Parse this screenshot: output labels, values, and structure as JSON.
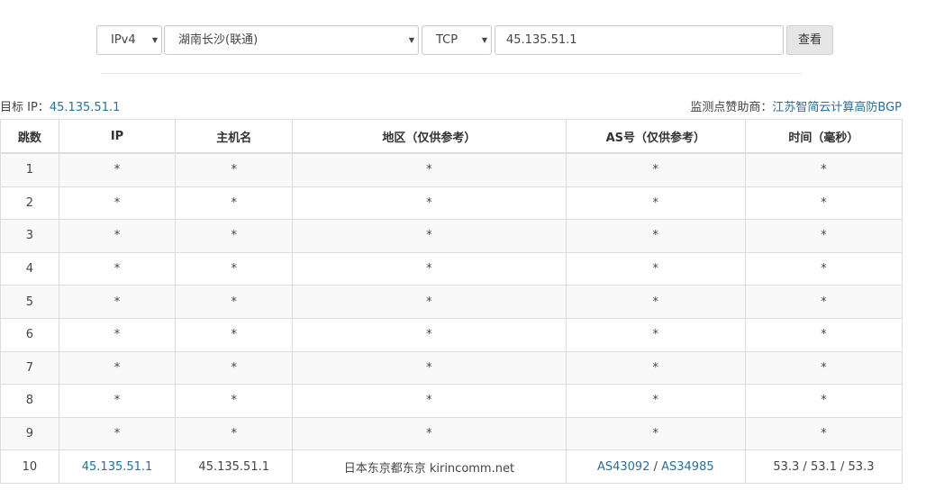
{
  "toolbar": {
    "ip_version": "IPv4",
    "node": "湖南长沙(联通)",
    "protocol": "TCP",
    "target_value": "45.135.51.1",
    "submit_label": "查看"
  },
  "info": {
    "target_label": "目标 IP：",
    "target_ip": "45.135.51.1",
    "sponsor_label": "监测点赞助商：",
    "sponsor_name": "江苏智简云计算高防BGP"
  },
  "table": {
    "headers": [
      "跳数",
      "IP",
      "主机名",
      "地区（仅供参考）",
      "AS号（仅供参考）",
      "时间（毫秒）"
    ],
    "rows": [
      {
        "hop": "1",
        "ip": "*",
        "host": "*",
        "location": "*",
        "as": "*",
        "time": "*"
      },
      {
        "hop": "2",
        "ip": "*",
        "host": "*",
        "location": "*",
        "as": "*",
        "time": "*"
      },
      {
        "hop": "3",
        "ip": "*",
        "host": "*",
        "location": "*",
        "as": "*",
        "time": "*"
      },
      {
        "hop": "4",
        "ip": "*",
        "host": "*",
        "location": "*",
        "as": "*",
        "time": "*"
      },
      {
        "hop": "5",
        "ip": "*",
        "host": "*",
        "location": "*",
        "as": "*",
        "time": "*"
      },
      {
        "hop": "6",
        "ip": "*",
        "host": "*",
        "location": "*",
        "as": "*",
        "time": "*"
      },
      {
        "hop": "7",
        "ip": "*",
        "host": "*",
        "location": "*",
        "as": "*",
        "time": "*"
      },
      {
        "hop": "8",
        "ip": "*",
        "host": "*",
        "location": "*",
        "as": "*",
        "time": "*"
      },
      {
        "hop": "9",
        "ip": "*",
        "host": "*",
        "location": "*",
        "as": "*",
        "time": "*"
      }
    ],
    "last_row": {
      "hop": "10",
      "ip": "45.135.51.1",
      "host": "45.135.51.1",
      "location": "日本东京都东京 kirincomm.net",
      "as1": "AS43092",
      "as_sep": " / ",
      "as2": "AS34985",
      "time": "53.3 / 53.1 / 53.3"
    }
  }
}
